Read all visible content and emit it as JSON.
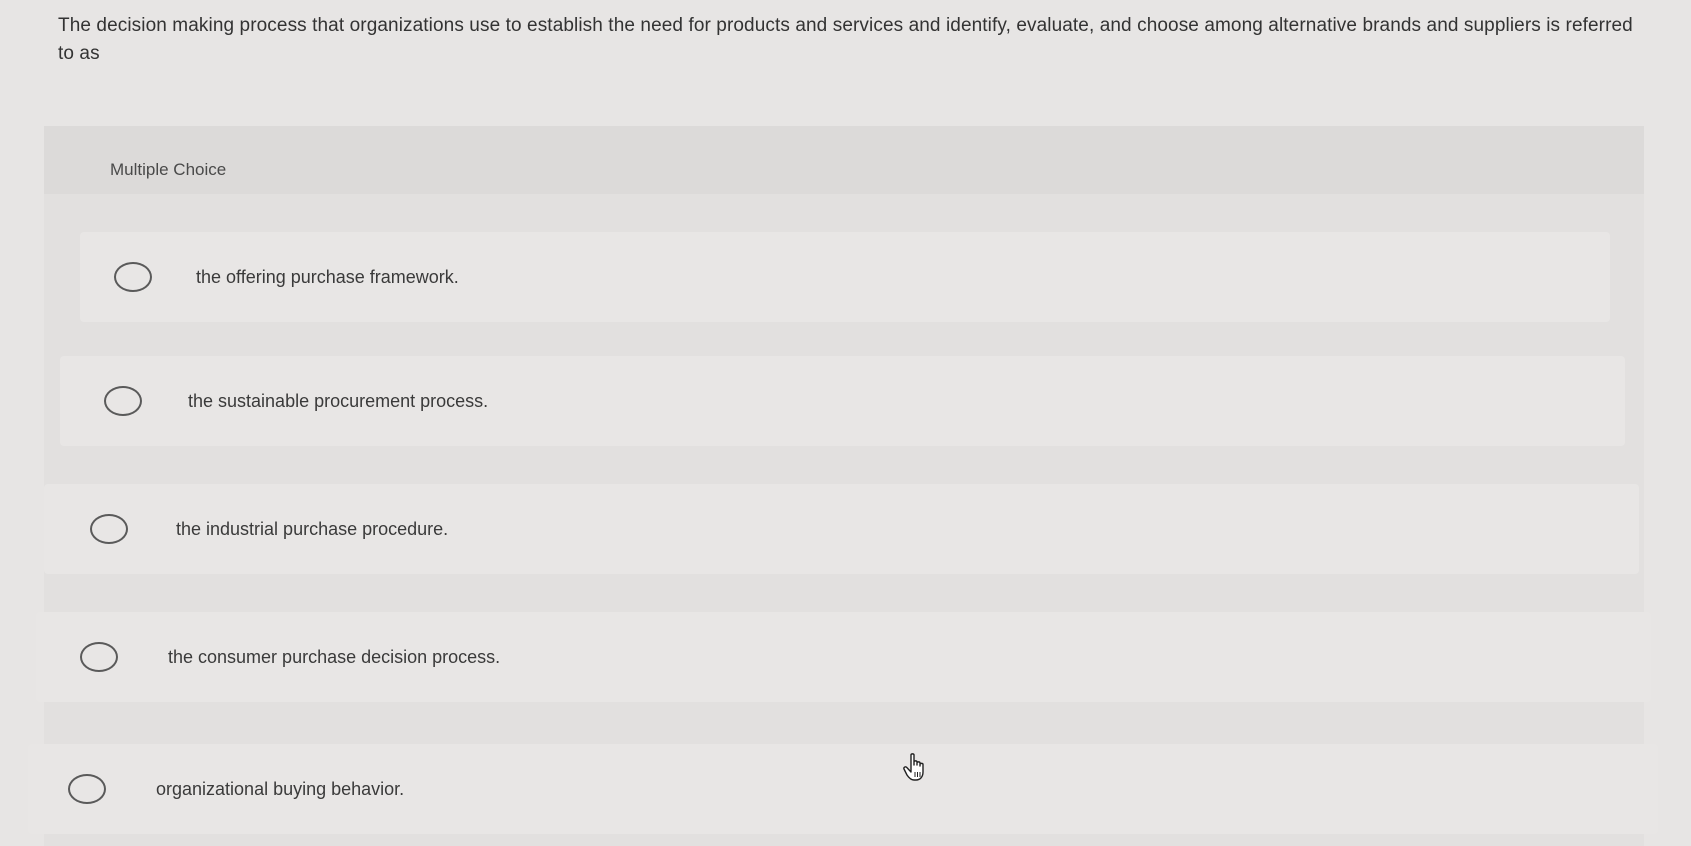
{
  "question": {
    "text": "The decision making process that organizations use to establish the need for products and services and identify, evaluate, and choose among alternative brands and suppliers is referred to as"
  },
  "multiple_choice": {
    "label": "Multiple Choice",
    "options": [
      {
        "label": "the offering purchase framework."
      },
      {
        "label": "the sustainable procurement process."
      },
      {
        "label": "the industrial purchase procedure."
      },
      {
        "label": "the consumer purchase decision process."
      },
      {
        "label": "organizational buying behavior."
      }
    ]
  },
  "icons": {
    "cursor": "hand-pointer-icon",
    "radio": "radio-button-icon"
  }
}
